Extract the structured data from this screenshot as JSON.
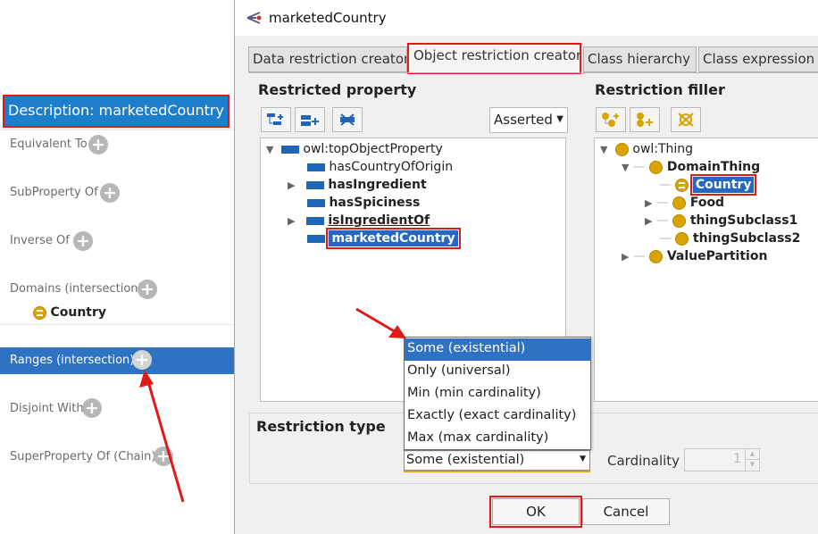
{
  "left_panel": {
    "header": "Description: marketedCountry",
    "sections": [
      {
        "label": "Equivalent To"
      },
      {
        "label": "SubProperty Of"
      },
      {
        "label": "Inverse Of"
      },
      {
        "label": "Domains (intersection)"
      },
      {
        "label": "Ranges (intersection)"
      },
      {
        "label": "Disjoint With"
      },
      {
        "label": "SuperProperty Of (Chain)"
      }
    ],
    "domain_item": "Country",
    "plus_glyph": "+"
  },
  "dialog": {
    "title": "marketedCountry",
    "tabs": [
      {
        "label": "Data restriction creator"
      },
      {
        "label": "Object restriction creator"
      },
      {
        "label": "Class hierarchy"
      },
      {
        "label": "Class expression"
      }
    ],
    "restricted_property": {
      "title": "Restricted property",
      "view_mode": "Asserted",
      "tree": [
        {
          "label": "owl:topObjectProperty"
        },
        {
          "label": "hasCountryOfOrigin"
        },
        {
          "label": "hasIngredient"
        },
        {
          "label": "hasSpiciness"
        },
        {
          "label": "isIngredientOf"
        },
        {
          "label": "marketedCountry"
        }
      ]
    },
    "restriction_filler": {
      "title": "Restriction filler",
      "tree": [
        {
          "label": "owl:Thing"
        },
        {
          "label": "DomainThing"
        },
        {
          "label": "Country"
        },
        {
          "label": "Food"
        },
        {
          "label": "thingSubclass1"
        },
        {
          "label": "thingSubclass2"
        },
        {
          "label": "ValuePartition"
        }
      ]
    },
    "restriction_type": {
      "title": "Restriction type",
      "selected": "Some (existential)",
      "options": [
        "Some (existential)",
        "Only (universal)",
        "Min (min cardinality)",
        "Exactly (exact cardinality)",
        "Max (max cardinality)"
      ],
      "cardinality_label": "Cardinality",
      "cardinality_value": "1"
    },
    "ok_label": "OK",
    "cancel_label": "Cancel"
  },
  "colors": {
    "highlight": "#e01919",
    "selection": "#2268c4",
    "property_icon": "#1f66b8",
    "class_icon": "#d9a400"
  }
}
